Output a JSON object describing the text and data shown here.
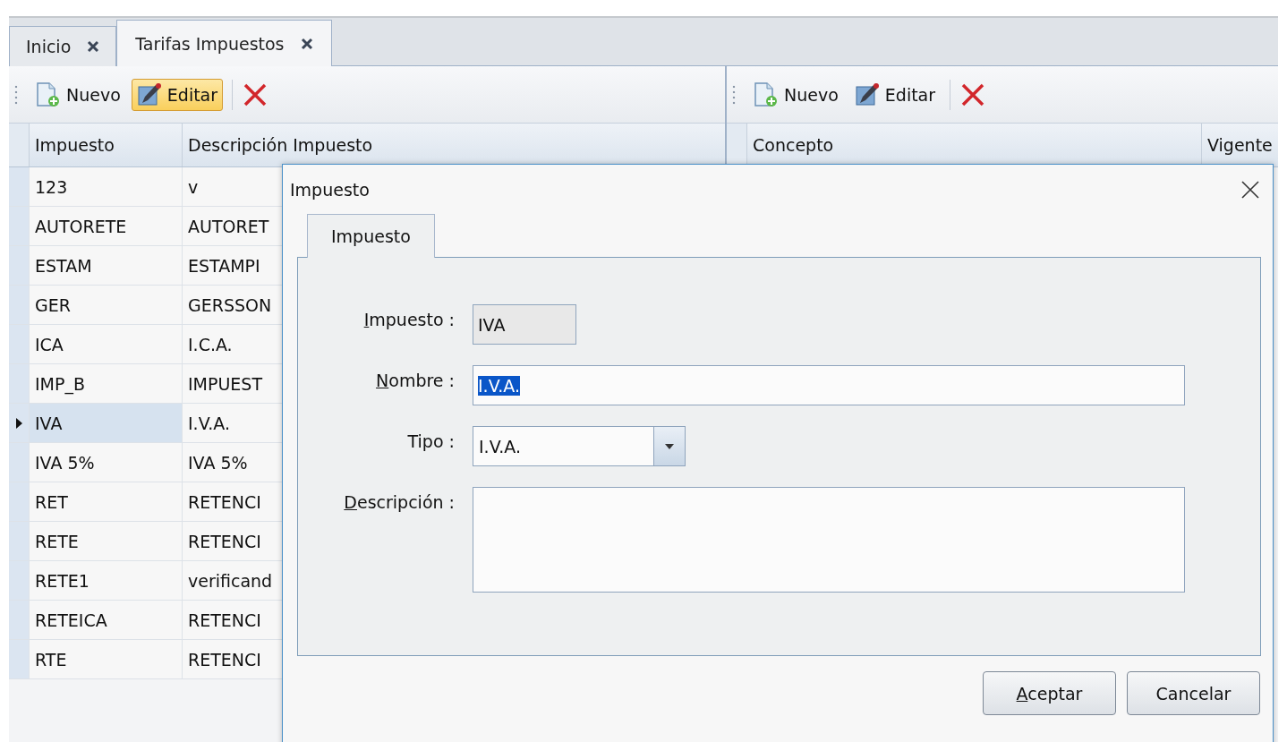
{
  "tabs": [
    {
      "label": "Inicio",
      "selected": false
    },
    {
      "label": "Tarifas Impuestos",
      "selected": true
    }
  ],
  "panes": [
    {
      "toolbar": [
        {
          "kind": "new",
          "label": "Nuevo",
          "pressed": false
        },
        {
          "kind": "edit",
          "label": "Editar",
          "pressed": true
        },
        {
          "kind": "delete"
        }
      ],
      "table": {
        "columns": [
          "Impuesto",
          "Descripción Impuesto"
        ],
        "rows": [
          {
            "cells": [
              "123",
              "v"
            ],
            "selected": false
          },
          {
            "cells": [
              "AUTORETE",
              "AUTORET"
            ],
            "selected": false
          },
          {
            "cells": [
              "ESTAM",
              "ESTAMPI"
            ],
            "selected": false
          },
          {
            "cells": [
              "GER",
              "GERSSON"
            ],
            "selected": false
          },
          {
            "cells": [
              "ICA",
              "I.C.A."
            ],
            "selected": false
          },
          {
            "cells": [
              "IMP_B",
              "IMPUEST"
            ],
            "selected": false
          },
          {
            "cells": [
              "IVA",
              "I.V.A."
            ],
            "selected": true
          },
          {
            "cells": [
              "IVA 5%",
              "IVA 5%"
            ],
            "selected": false
          },
          {
            "cells": [
              "RET",
              "RETENCI"
            ],
            "selected": false
          },
          {
            "cells": [
              "RETE",
              "RETENCI"
            ],
            "selected": false
          },
          {
            "cells": [
              "RETE1",
              "verificand"
            ],
            "selected": false
          },
          {
            "cells": [
              "RETEICA",
              "RETENCI"
            ],
            "selected": false
          },
          {
            "cells": [
              "RTE",
              "RETENCI"
            ],
            "selected": false
          }
        ]
      }
    },
    {
      "toolbar": [
        {
          "kind": "new",
          "label": "Nuevo",
          "pressed": false
        },
        {
          "kind": "edit",
          "label": "Editar",
          "pressed": false
        },
        {
          "kind": "delete"
        }
      ],
      "table": {
        "columns": [
          "Concepto",
          "Vigente"
        ]
      }
    }
  ],
  "dialog": {
    "title": "Impuesto",
    "tabs": [
      {
        "label": "Impuesto",
        "selected": true
      }
    ],
    "fields": [
      {
        "kind": "readonly",
        "label": "Impuesto :",
        "mnemonic": true,
        "value": "IVA"
      },
      {
        "kind": "text",
        "label": "Nombre :",
        "mnemonic": true,
        "value": "I.V.A.",
        "value_selected": true
      },
      {
        "kind": "combo",
        "label": "Tipo :",
        "mnemonic": false,
        "value": "I.V.A."
      },
      {
        "kind": "textarea",
        "label": "Descripción :",
        "mnemonic": true
      }
    ],
    "buttons": [
      {
        "label": "Aceptar",
        "mnemonic": true
      },
      {
        "label": "Cancelar",
        "mnemonic": false
      }
    ]
  }
}
